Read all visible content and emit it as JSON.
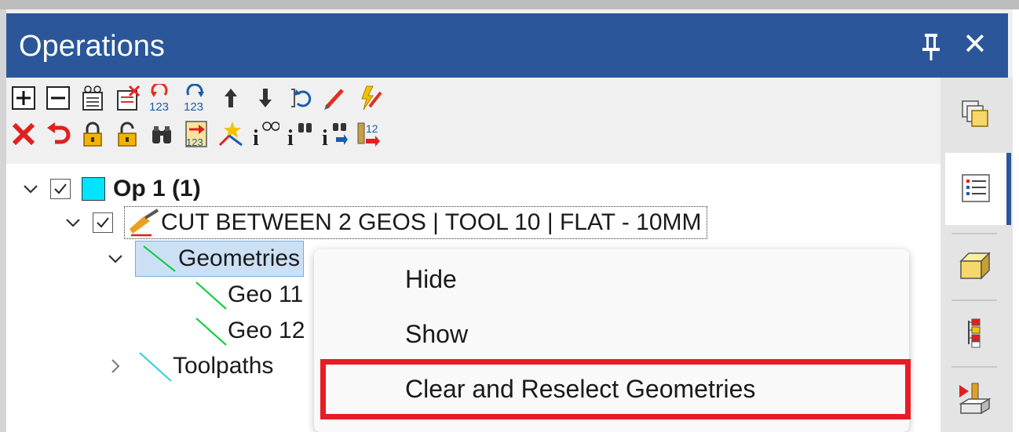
{
  "panel": {
    "title": "Operations",
    "pin_icon": "pin-icon",
    "close_label": "✕"
  },
  "toolbar": {
    "row1": [
      "expand-all-icon",
      "collapse-all-icon",
      "view-operation-icon",
      "delete-operation-icon",
      "renumber-icon",
      "renumber-tools-icon",
      "move-up-icon",
      "move-down-icon",
      "regenerate-icon",
      "edit-icon",
      "batch-edit-icon"
    ],
    "row2": [
      "delete-icon",
      "undo-icon",
      "lock-icon",
      "unlock-icon",
      "find-icon",
      "transfer-icon",
      "toolpath-link-icon",
      "info-view-icon",
      "info-find-icon",
      "info-next-icon",
      "tool-number-icon"
    ],
    "renumber_text": "123",
    "tool_num_text": "12"
  },
  "tree": {
    "op_label": "Op 1 (1)",
    "operation_label": "CUT BETWEEN 2 GEOS | TOOL 10 | FLAT - 10MM",
    "geometries_label": "Geometries",
    "geo_items": [
      "Geo 11",
      "Geo 12"
    ],
    "toolpaths_label": "Toolpaths",
    "swatch_color": "#00e5ff",
    "geo_line_color": "#00cc33",
    "toolpath_line_color": "#33ccdd"
  },
  "context_menu": {
    "items": [
      "Hide",
      "Show",
      "Clear and Reselect Geometries"
    ],
    "highlight_color": "#e81c24"
  },
  "sidebar": {
    "icons": [
      "stock-view-icon",
      "operations-tab-icon",
      "solid-icon",
      "tree-structure-icon",
      "simulate-icon"
    ]
  },
  "colors": {
    "titlebar": "#2b579a"
  }
}
